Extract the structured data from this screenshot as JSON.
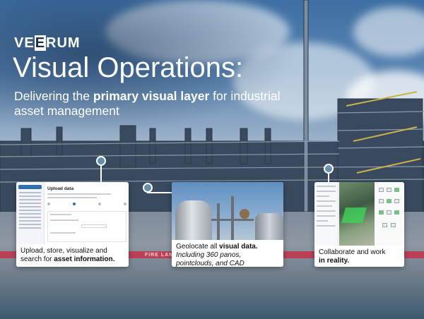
{
  "brand": {
    "logo_text": "VE RUM",
    "logo_highlight": "E"
  },
  "hero": {
    "headline": "Visual Operations:",
    "subtitle_pre": "Delivering the ",
    "subtitle_bold": "primary visual layer",
    "subtitle_post": " for industrial asset management"
  },
  "ground": {
    "marking_text": "FIRE LANE"
  },
  "cards": [
    {
      "caption_pre": "Upload, store, visualize and search for ",
      "caption_bold": "asset information.",
      "screen_title": "Upload data"
    },
    {
      "caption_pre": "Geolocate all ",
      "caption_bold": "visual data.",
      "caption_italic": "Including 360 panos, pointclouds, and CAD"
    },
    {
      "caption_pre": "Collaborate and work ",
      "caption_bold": "in reality."
    }
  ],
  "colors": {
    "accent": "#2f6fb0",
    "fire_lane": "#c4324a",
    "highlight_green": "#3fd35a"
  }
}
